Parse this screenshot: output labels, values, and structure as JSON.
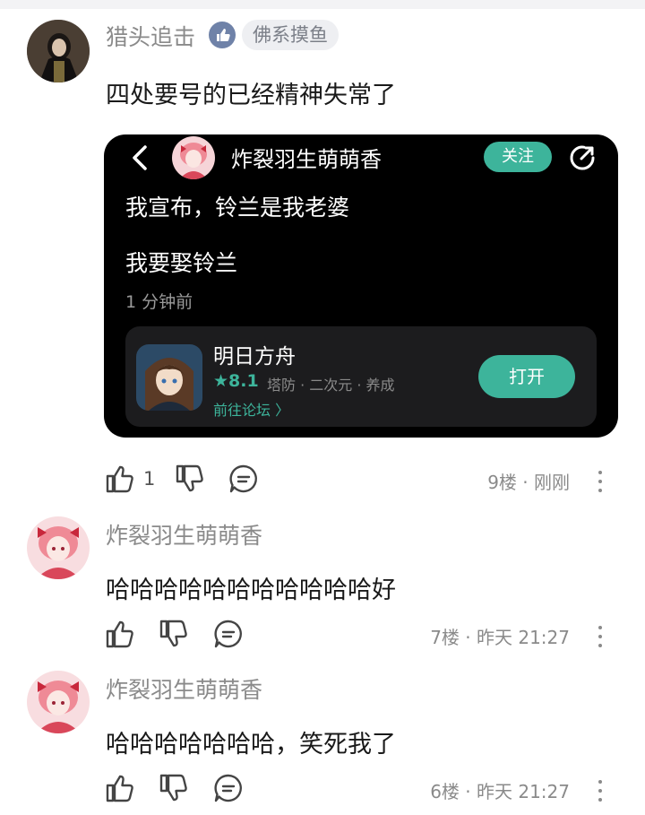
{
  "comments": [
    {
      "username": "猎头追击",
      "badge": "佛系摸鱼",
      "text": "四处要号的已经精神失常了",
      "likes": "1",
      "meta": "9楼 · 刚刚",
      "embed": {
        "poster": "炸裂羽生萌萌香",
        "follow_label": "关注",
        "line1": "我宣布，铃兰是我老婆",
        "line2": "我要娶铃兰",
        "time": "1 分钟前",
        "app": {
          "name": "明日方舟",
          "rating": "★8.1",
          "tags": "塔防 · 二次元 · 养成",
          "forum_link": "前往论坛 〉",
          "open_label": "打开"
        }
      }
    },
    {
      "username": "炸裂羽生萌萌香",
      "text": "哈哈哈哈哈哈哈哈哈哈哈好",
      "meta": "7楼 · 昨天 21:27"
    },
    {
      "username": "炸裂羽生萌萌香",
      "text": "哈哈哈哈哈哈哈，笑死我了",
      "meta": "6楼 · 昨天 21:27"
    }
  ],
  "colors": {
    "accent": "#3db49b",
    "meta_gray": "#8a8a8a",
    "embed_bg": "#000000"
  }
}
